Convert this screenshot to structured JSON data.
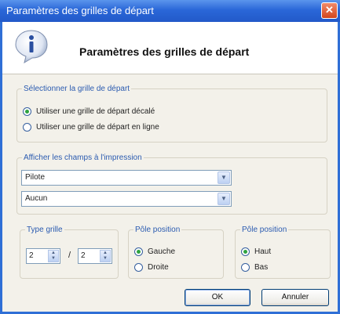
{
  "window": {
    "title": "Paramètres des grilles de départ",
    "close_glyph": "✕"
  },
  "header": {
    "title": "Paramètres des grilles de départ",
    "icon": "info-icon"
  },
  "grid_select": {
    "legend": "Sélectionner la grille de départ",
    "options": [
      {
        "label": "Utiliser une grille de départ décalé",
        "checked": true
      },
      {
        "label": "Utiliser une grille de départ en ligne",
        "checked": false
      }
    ]
  },
  "print_fields": {
    "legend": "Afficher les champs à l'impression",
    "combo1_value": "Pilote",
    "combo2_value": "Aucun"
  },
  "grid_type": {
    "legend": "Type grille",
    "value1": "2",
    "separator": "/",
    "value2": "2"
  },
  "pole_position_1": {
    "legend": "Pôle position",
    "options": [
      {
        "label": "Gauche",
        "checked": true
      },
      {
        "label": "Droite",
        "checked": false
      }
    ]
  },
  "pole_position_2": {
    "legend": "Pôle position",
    "options": [
      {
        "label": "Haut",
        "checked": true
      },
      {
        "label": "Bas",
        "checked": false
      }
    ]
  },
  "buttons": {
    "ok": "OK",
    "cancel": "Annuler"
  }
}
